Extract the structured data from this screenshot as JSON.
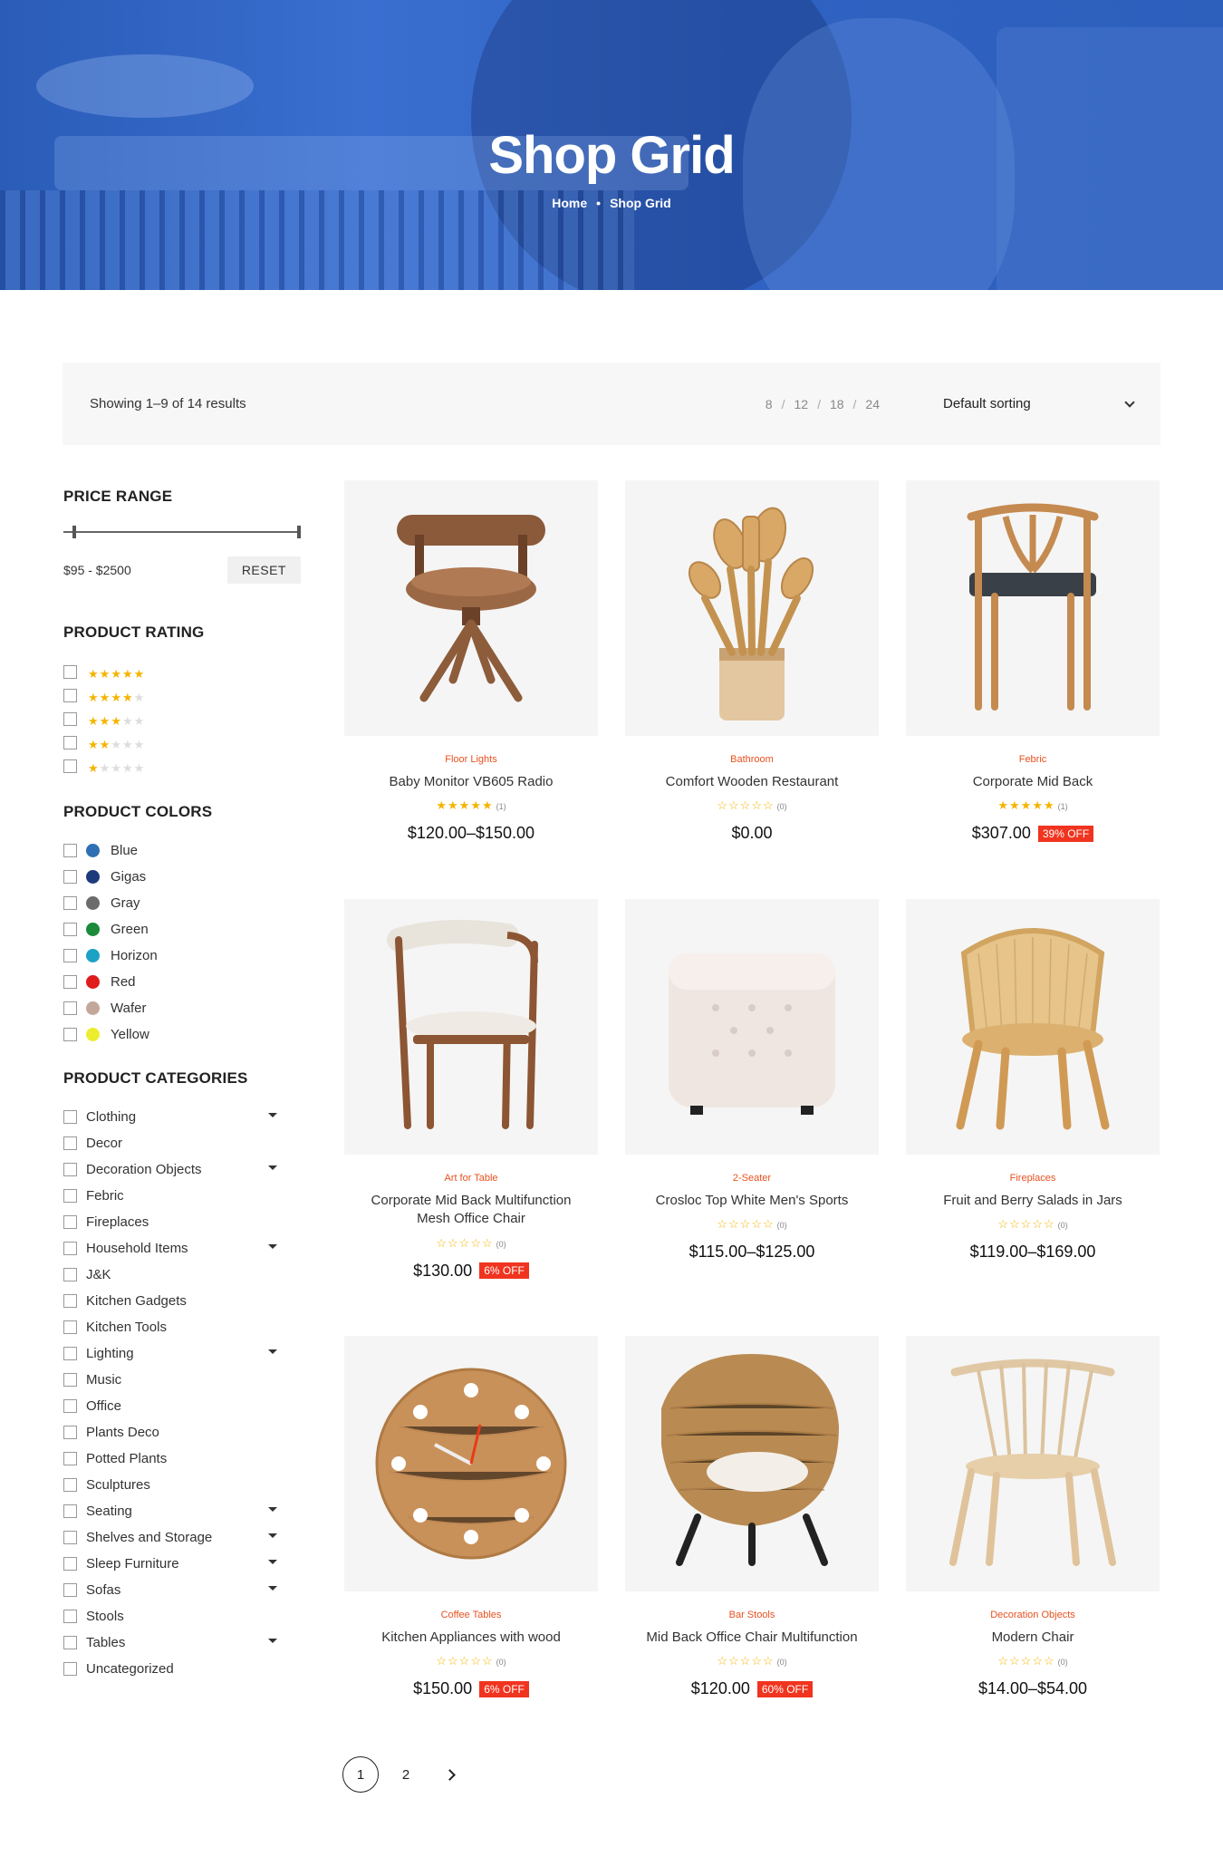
{
  "hero": {
    "title": "Shop Grid",
    "crumb_home": "Home",
    "crumb_current": "Shop Grid"
  },
  "toolbar": {
    "result_count": "Showing 1–9 of 14 results",
    "per_page": [
      "8",
      "12",
      "18",
      "24"
    ],
    "sort_label": "Default sorting"
  },
  "sidebar": {
    "price": {
      "title": "PRICE RANGE",
      "range_text": "$95 - $2500",
      "reset_label": "RESET"
    },
    "rating": {
      "title": "PRODUCT RATING",
      "options": [
        5,
        4,
        3,
        2,
        1
      ]
    },
    "colors": {
      "title": "PRODUCT COLORS",
      "items": [
        {
          "label": "Blue",
          "color": "#2f6fb3"
        },
        {
          "label": "Gigas",
          "color": "#1d3a7a"
        },
        {
          "label": "Gray",
          "color": "#6b6b6b"
        },
        {
          "label": "Green",
          "color": "#1b8a3a"
        },
        {
          "label": "Horizon",
          "color": "#1ca2c4"
        },
        {
          "label": "Red",
          "color": "#e01b1b"
        },
        {
          "label": "Wafer",
          "color": "#c4a79b"
        },
        {
          "label": "Yellow",
          "color": "#eded2f"
        }
      ]
    },
    "categories": {
      "title": "PRODUCT CATEGORIES",
      "items": [
        {
          "label": "Clothing",
          "expandable": true
        },
        {
          "label": "Decor",
          "expandable": false
        },
        {
          "label": "Decoration Objects",
          "expandable": true
        },
        {
          "label": "Febric",
          "expandable": false
        },
        {
          "label": "Fireplaces",
          "expandable": false
        },
        {
          "label": "Household Items",
          "expandable": true
        },
        {
          "label": "J&K",
          "expandable": false
        },
        {
          "label": "Kitchen Gadgets",
          "expandable": false
        },
        {
          "label": "Kitchen Tools",
          "expandable": false
        },
        {
          "label": "Lighting",
          "expandable": true
        },
        {
          "label": "Music",
          "expandable": false
        },
        {
          "label": "Office",
          "expandable": false
        },
        {
          "label": "Plants Deco",
          "expandable": false
        },
        {
          "label": "Potted Plants",
          "expandable": false
        },
        {
          "label": "Sculptures",
          "expandable": false
        },
        {
          "label": "Seating",
          "expandable": true
        },
        {
          "label": "Shelves and Storage",
          "expandable": true
        },
        {
          "label": "Sleep Furniture",
          "expandable": true
        },
        {
          "label": "Sofas",
          "expandable": true
        },
        {
          "label": "Stools",
          "expandable": false
        },
        {
          "label": "Tables",
          "expandable": true
        },
        {
          "label": "Uncategorized",
          "expandable": false
        }
      ]
    }
  },
  "products": [
    {
      "category": "Floor Lights",
      "name": "Baby Monitor VB605 Radio",
      "rating": 5,
      "count": "(1)",
      "price": "$120.00–$150.00",
      "badge": "",
      "icon": "swivel-chair-icon"
    },
    {
      "category": "Bathroom",
      "name": "Comfort Wooden Restaurant",
      "rating": 0,
      "count": "(0)",
      "price": "$0.00",
      "badge": "",
      "icon": "wooden-utensils-icon"
    },
    {
      "category": "Febric",
      "name": "Corporate Mid Back",
      "rating": 5,
      "count": "(1)",
      "price": "$307.00",
      "badge": "39% OFF",
      "icon": "wishbone-chair-icon"
    },
    {
      "category": "Art for Table",
      "name": "Corporate Mid Back Multifunction Mesh Office Chair",
      "rating": 0,
      "count": "(0)",
      "price": "$130.00",
      "badge": "6% OFF",
      "icon": "dining-chair-icon"
    },
    {
      "category": "2-Seater",
      "name": "Crosloc Top White Men's Sports",
      "rating": 0,
      "count": "(0)",
      "price": "$115.00–$125.00",
      "badge": "",
      "icon": "ottoman-icon"
    },
    {
      "category": "Fireplaces",
      "name": "Fruit and Berry Salads in Jars",
      "rating": 0,
      "count": "(0)",
      "price": "$119.00–$169.00",
      "badge": "",
      "icon": "rattan-chair-icon"
    },
    {
      "category": "Coffee Tables",
      "name": "Kitchen Appliances with wood",
      "rating": 0,
      "count": "(0)",
      "price": "$150.00",
      "badge": "6% OFF",
      "icon": "wall-clock-icon"
    },
    {
      "category": "Bar Stools",
      "name": "Mid Back Office Chair Multifunction",
      "rating": 0,
      "count": "(0)",
      "price": "$120.00",
      "badge": "60% OFF",
      "icon": "egg-chair-icon"
    },
    {
      "category": "Decoration Objects",
      "name": "Modern Chair",
      "rating": 0,
      "count": "(0)",
      "price": "$14.00–$54.00",
      "badge": "",
      "icon": "spindle-chair-icon"
    }
  ],
  "pagination": {
    "pages": [
      "1",
      "2"
    ],
    "current": "1"
  }
}
